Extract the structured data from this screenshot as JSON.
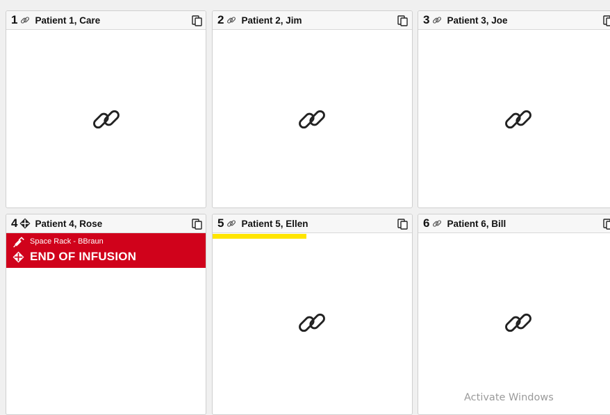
{
  "tiles": [
    {
      "number": "1",
      "name": "Patient 1, Care",
      "status": "linked"
    },
    {
      "number": "2",
      "name": "Patient 2, Jim",
      "status": "linked"
    },
    {
      "number": "3",
      "name": "Patient 3, Joe",
      "status": "linked"
    },
    {
      "number": "4",
      "name": "Patient 4, Rose",
      "status": "alarm",
      "alarm": {
        "source": "Space Rack - BBraun",
        "message": "END OF INFUSION",
        "color": "#d0021b"
      }
    },
    {
      "number": "5",
      "name": "Patient 5, Ellen",
      "status": "linked",
      "selected": true
    },
    {
      "number": "6",
      "name": "Patient 6, Bill",
      "status": "linked"
    }
  ],
  "colors": {
    "alarm": "#d0021b",
    "selection": "#ffe500",
    "tile_bg": "#ffffff",
    "header_bg": "#f7f7f7"
  },
  "icons": {
    "link": "link-icon",
    "device": "device-icon",
    "syringe": "syringe-icon",
    "end-of-infusion": "end-of-infusion-icon"
  },
  "watermark": "Activate Windows"
}
